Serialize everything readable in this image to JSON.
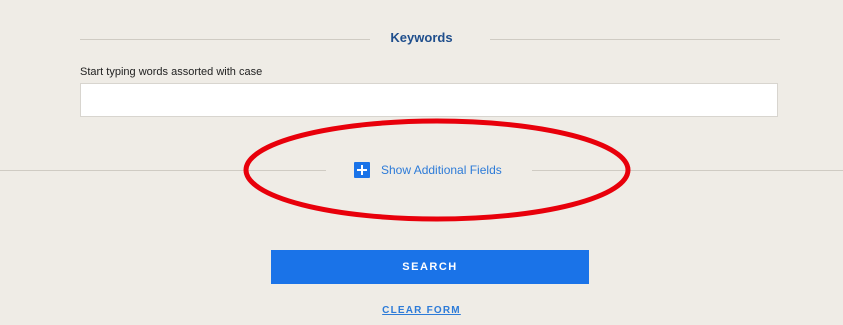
{
  "keywords": {
    "title": "Keywords",
    "label": "Start typing words assorted with case",
    "value": "",
    "placeholder": ""
  },
  "additional_fields": {
    "label": "Show Additional Fields",
    "icon": "plus-icon"
  },
  "actions": {
    "search_label": "SEARCH",
    "clear_label": "CLEAR FORM"
  },
  "colors": {
    "background": "#efece6",
    "accent": "#1a73e8",
    "title": "#1f4e8c",
    "annotation": "#e8000b"
  }
}
